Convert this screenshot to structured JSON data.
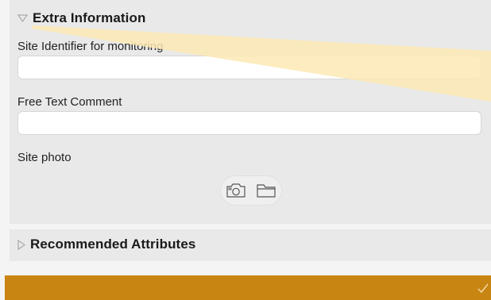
{
  "extra_section": {
    "title": "Extra Information",
    "site_identifier_label": "Site Identifier for monitoring",
    "site_identifier_value": "",
    "free_text_label": "Free Text Comment",
    "free_text_value": "",
    "site_photo_label": "Site photo"
  },
  "recommended_section": {
    "title": "Recommended Attributes"
  },
  "icons": {
    "extra_toggle": "triangle-down-icon",
    "recommended_toggle": "triangle-right-icon",
    "camera": "camera-icon",
    "folder": "folder-icon",
    "confirm": "checkmark-icon"
  },
  "colors": {
    "accent": "#c88512",
    "panel": "#e9e9e9",
    "highlight_beam": "#fde9b4"
  }
}
